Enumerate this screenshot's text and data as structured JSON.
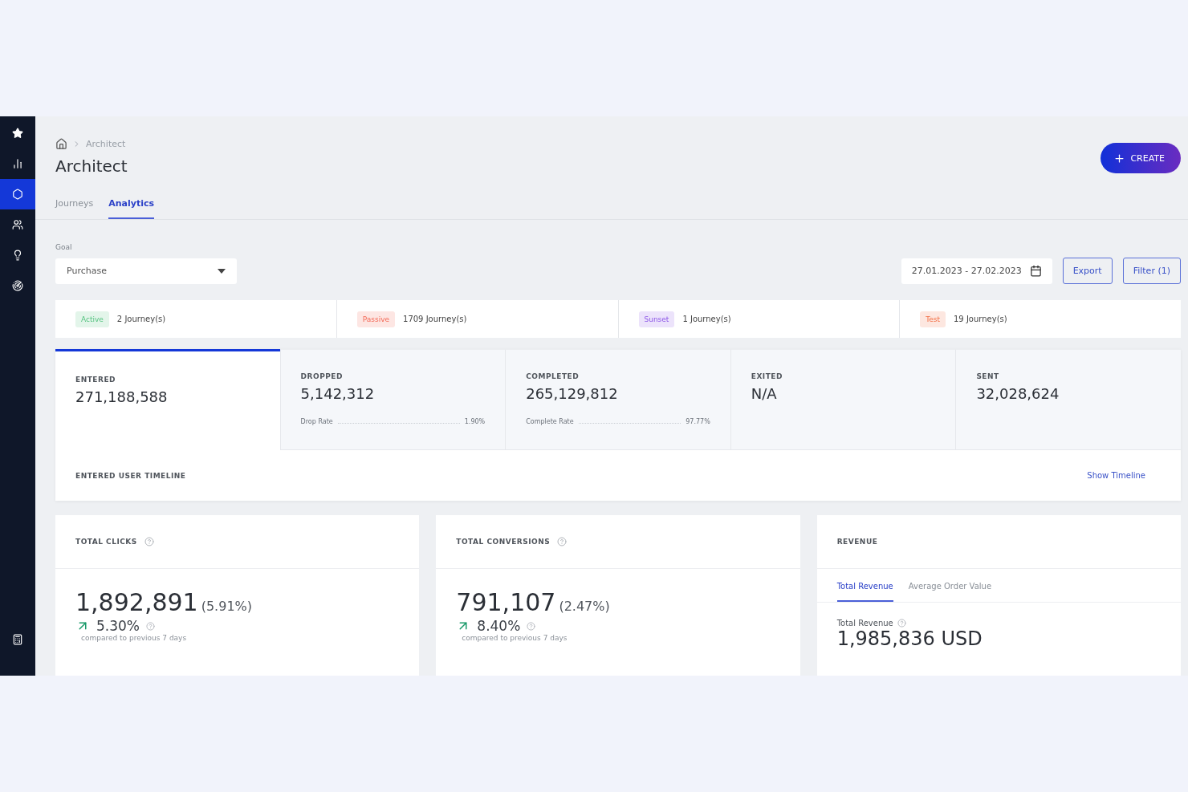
{
  "sidebar": {
    "items": [
      {
        "selected": false
      },
      {
        "selected": false
      },
      {
        "selected": true
      },
      {
        "selected": false
      },
      {
        "selected": false
      },
      {
        "selected": false
      }
    ],
    "bottom_items": [
      {
        "selected": false
      }
    ]
  },
  "breadcrumb": {
    "current": "Architect"
  },
  "page_title": "Architect",
  "create_button": "CREATE",
  "tabs": [
    {
      "label": "Journeys",
      "selected": false
    },
    {
      "label": "Analytics",
      "selected": true
    }
  ],
  "goal": {
    "label": "Goal",
    "value": "Purchase"
  },
  "date_range": "27.01.2023 - 27.02.2023",
  "buttons": [
    "Export",
    "Filter (1)"
  ],
  "journey_statuses": [
    {
      "status": "Active",
      "count": "2 Journey(s)",
      "color": "#e3f5ea"
    },
    {
      "status": "Passive",
      "count": "1709 Journey(s)",
      "color": "#fde6e3"
    },
    {
      "status": "Sunset",
      "count": "1 Journey(s)",
      "color": "#ece3fb"
    },
    {
      "status": "Test",
      "count": "19 Journey(s)",
      "color": "#fde7e0"
    }
  ],
  "stages": [
    {
      "label": "ENTERED",
      "value": "271,188,588",
      "selected": true
    },
    {
      "label": "DROPPED",
      "value": "5,142,312",
      "selected": false,
      "rate_label": "Drop Rate",
      "rate": "1.90%"
    },
    {
      "label": "COMPLETED",
      "value": "265,129,812",
      "selected": false,
      "rate_label": "Complete Rate",
      "rate": "97.77%"
    },
    {
      "label": "EXITED",
      "value": "N/A",
      "selected": false
    },
    {
      "label": "SENT",
      "value": "32,028,624",
      "selected": false
    }
  ],
  "timeline": {
    "title": "ENTERED USER TIMELINE",
    "link": "Show Timeline"
  },
  "metrics": [
    {
      "title": "TOTAL CLICKS",
      "value": "1,892,891",
      "share": "(5.91%)",
      "change": "5.30%",
      "note": "compared to previous 7 days"
    },
    {
      "title": "TOTAL CONVERSIONS",
      "value": "791,107",
      "share": "(2.47%)",
      "change": "8.40%",
      "note": "compared to previous 7 days"
    }
  ],
  "revenue": {
    "title": "REVENUE",
    "tabs": [
      {
        "label": "Total Revenue",
        "selected": true
      },
      {
        "label": "Average Order Value",
        "selected": false
      }
    ],
    "label": "Total Revenue",
    "value": "1,985,836 USD"
  }
}
